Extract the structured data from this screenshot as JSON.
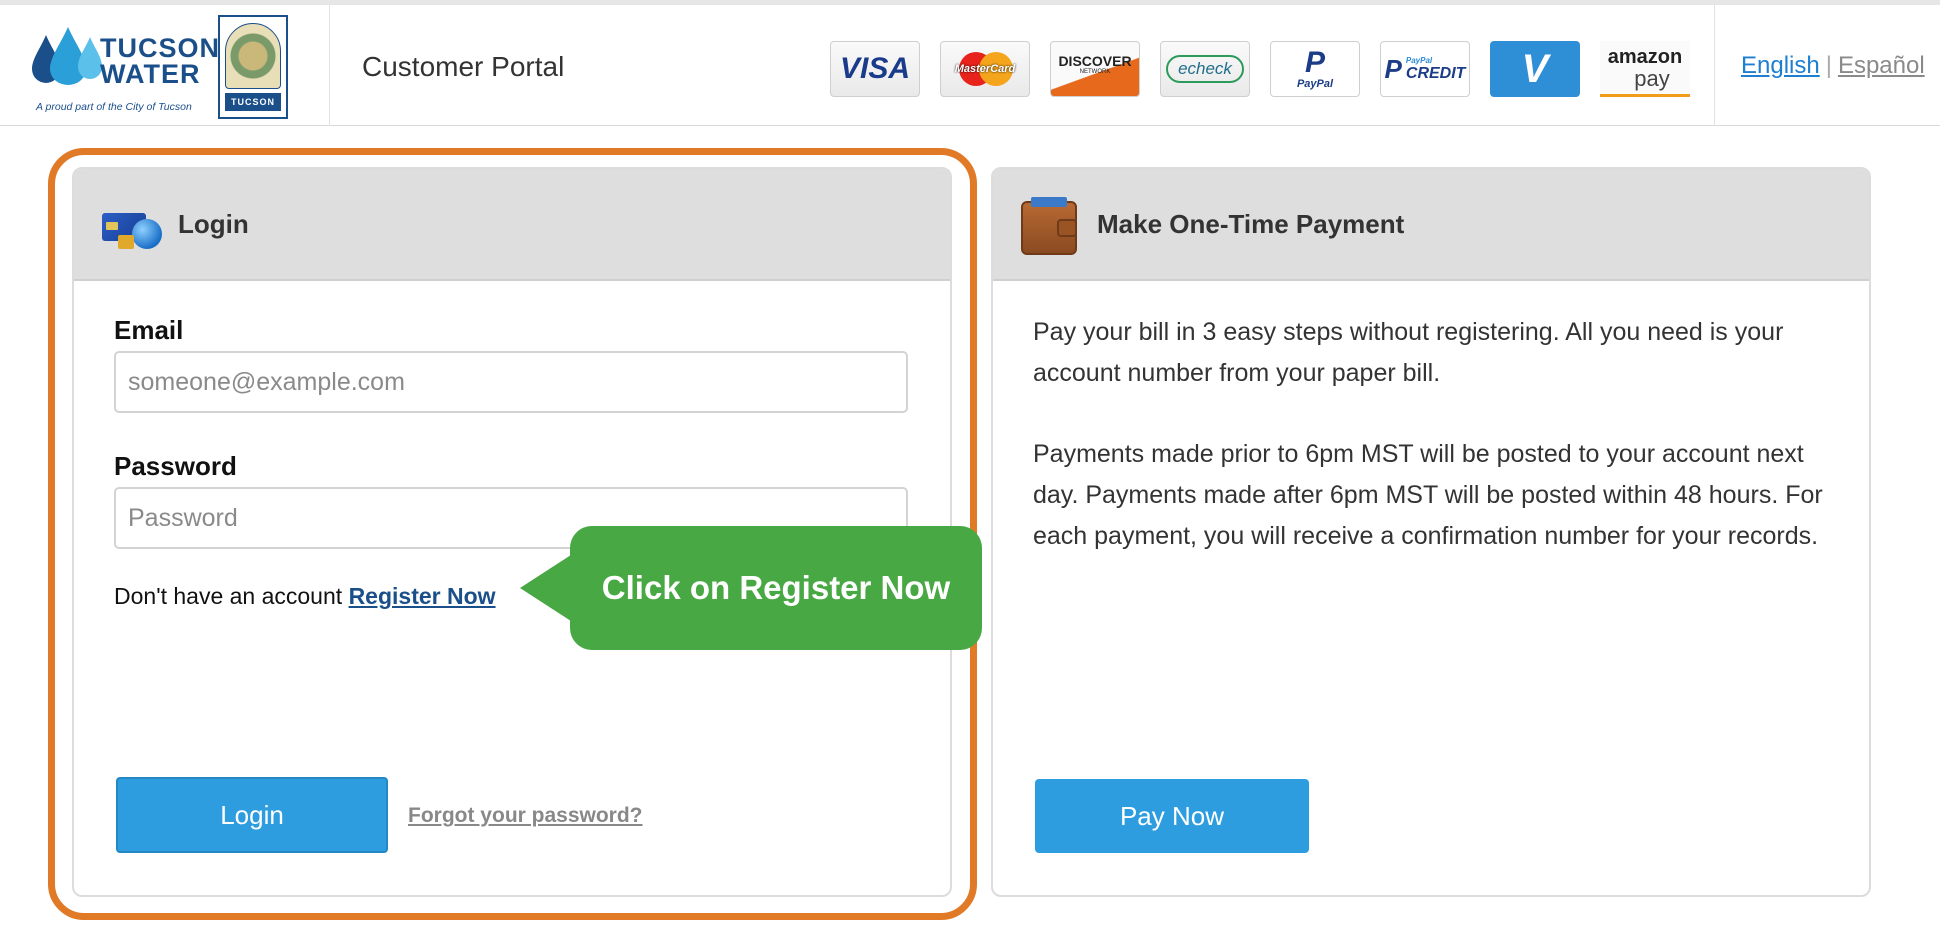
{
  "header": {
    "logo_line1": "TUCSON",
    "logo_line2": "WATER",
    "logo_tagline": "A proud part of the City of Tucson",
    "seal_text": "TUCSON",
    "portal_title": "Customer Portal",
    "payment_methods": [
      {
        "name": "visa-icon",
        "label": "VISA"
      },
      {
        "name": "mastercard-icon",
        "label": "MasterCard"
      },
      {
        "name": "discover-icon",
        "label": "DISCOVER",
        "sub": "NETWORK"
      },
      {
        "name": "echeck-icon",
        "label": "echeck"
      },
      {
        "name": "paypal-icon",
        "label": "PayPal"
      },
      {
        "name": "paypal-credit-icon",
        "label_small": "PayPal",
        "label_big": "CREDIT"
      },
      {
        "name": "venmo-icon",
        "label": "V"
      },
      {
        "name": "amazon-pay-icon",
        "label": "amazon",
        "sub": "pay"
      }
    ],
    "language": {
      "english": "English",
      "separator": "|",
      "spanish": "Español"
    }
  },
  "login": {
    "title": "Login",
    "email_label": "Email",
    "email_placeholder": "someone@example.com",
    "email_value": "",
    "password_label": "Password",
    "password_placeholder": "Password",
    "password_value": "",
    "register_prompt": "Don't have an account",
    "register_link": "Register Now",
    "login_button": "Login",
    "forgot_link": "Forgot your password?"
  },
  "payment": {
    "title": "Make One-Time Payment",
    "paragraph1": "Pay your bill in 3 easy steps without registering. All you need is your account number from your paper bill.",
    "paragraph2": "Payments made prior to 6pm MST will be posted to your account next day. Payments made after 6pm MST will be posted within 48 hours. For each payment, you will receive a confirmation number for your records.",
    "pay_button": "Pay Now"
  },
  "annotation": {
    "callout_text": "Click on Register Now",
    "highlight_color": "#e07a26",
    "callout_color": "#48a843"
  },
  "colors": {
    "primary_button": "#2d9de0",
    "link": "#1b4f8a",
    "panel_header": "#dedede"
  }
}
